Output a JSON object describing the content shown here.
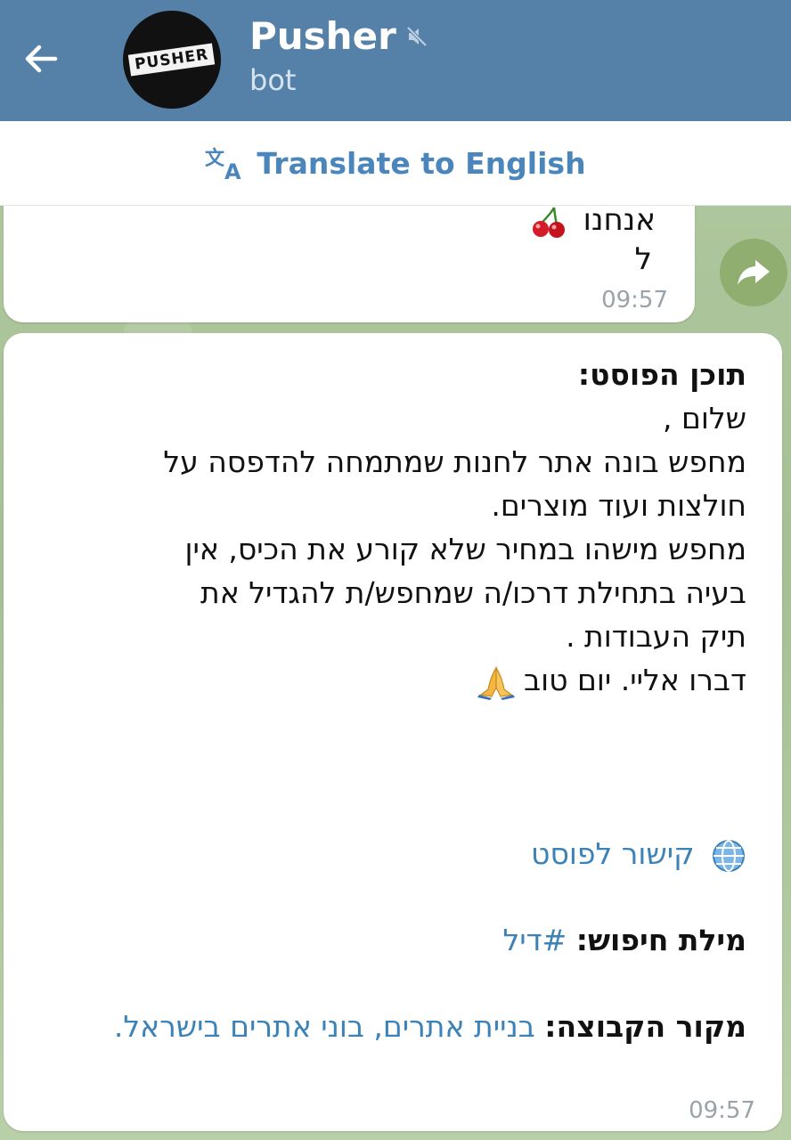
{
  "colors": {
    "header_bg": "#5580a8",
    "accent": "#4a86bb",
    "link": "#3b82b8",
    "chat_bg": "#a9c29a"
  },
  "header": {
    "back_icon": "arrow-left-icon",
    "avatar_text": "PUSHER",
    "title": "Pusher",
    "mute_icon": "muted-icon",
    "subtitle": "bot"
  },
  "translate": {
    "icon": "translate-icon",
    "label": "Translate to English"
  },
  "messages": [
    {
      "lines": [
        "אנחנו",
        "ל"
      ],
      "emoji": "cherries-icon",
      "time": "09:57"
    },
    {
      "heading": "תוכן הפוסט:",
      "body_lines": [
        "שלום ,",
        "מחפש בונה אתר לחנות שמתמחה להדפסה על",
        "חולצות ועוד מוצרים.",
        "מחפש מישהו במחיר שלא קורע את הכיס, אין",
        "בעיה בתחילת דרכו/ה שמחפש/ת להגדיל את",
        "תיק העבודות ."
      ],
      "closing": "דברו אליי. יום טוב",
      "closing_emoji": "pray-icon",
      "post_link": "קישור לפוסט",
      "keyword_label": "מילת חיפוש:",
      "keyword_value": "#דיל",
      "source_label": "מקור הקבוצה:",
      "source_value": "בניית אתרים, בוני אתרים בישראל.",
      "time": "09:57"
    }
  ],
  "share_icon": "share-forward-icon"
}
